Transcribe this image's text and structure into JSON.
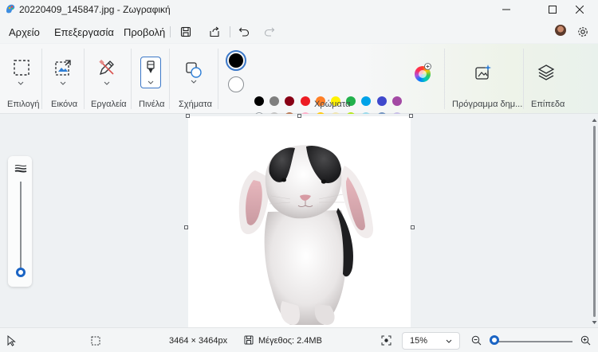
{
  "window": {
    "title": "20220409_145847.jpg - Ζωγραφική"
  },
  "menu": {
    "file": "Αρχείο",
    "edit": "Επεξεργασία",
    "view": "Προβολή"
  },
  "ribbon": {
    "groups": {
      "selection": "Επιλογή",
      "image": "Εικόνα",
      "tools": "Εργαλεία",
      "brushes": "Πινέλα",
      "shapes": "Σχήματα",
      "colors": "Χρώματα",
      "cocreator": "Πρόγραμμα δημ...",
      "layers": "Επίπεδα"
    },
    "primary_color": "#000000",
    "secondary_color": "#ffffff",
    "palette_row1": [
      "#000000",
      "#7f7f7f",
      "#880015",
      "#ed1c24",
      "#ff7f27",
      "#fff200",
      "#22b14c",
      "#00a2e8",
      "#3f48cc",
      "#a349a4"
    ],
    "palette_row2": [
      "#ffffff",
      "#c3c3c3",
      "#b97a57",
      "#ffaec9",
      "#ffc90e",
      "#efe4b0",
      "#b5e61d",
      "#99d9ea",
      "#7092be",
      "#c8bfe7"
    ]
  },
  "status": {
    "dimensions": "3464 × 3464px",
    "file_size": "Μέγεθος: 2.4MB",
    "zoom": "15%"
  },
  "colors": {
    "accent": "#1a64c4"
  }
}
